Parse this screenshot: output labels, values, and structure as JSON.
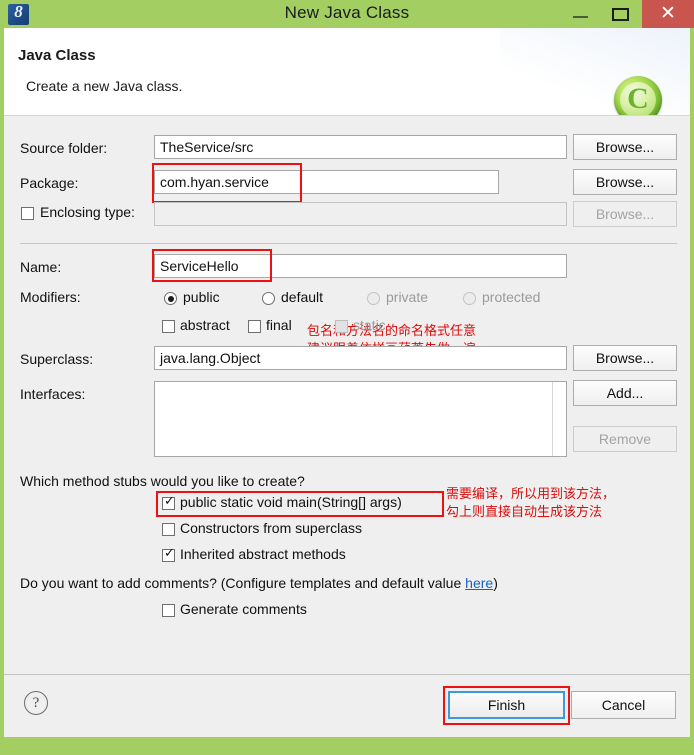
{
  "window": {
    "title": "New Java Class",
    "app_icon": "eclipse-icon",
    "minimize_label": "Minimize",
    "maximize_label": "Maximize",
    "close_label": "Close",
    "close_color": "#c9554f",
    "titlebar_color": "#a3cf62"
  },
  "header": {
    "title": "Java Class",
    "subtitle": "Create a new Java class.",
    "icon": "java-class-icon",
    "icon_letter": "C"
  },
  "form": {
    "source_folder": {
      "label": "Source folder:",
      "value": "TheService/src",
      "browse": "Browse..."
    },
    "package": {
      "label": "Package:",
      "value": "com.hyan.service",
      "browse": "Browse..."
    },
    "enclosing_type": {
      "label": "Enclosing type:",
      "checked": false,
      "value": "",
      "browse": "Browse..."
    },
    "name": {
      "label": "Name:",
      "value": "ServiceHello"
    },
    "modifiers": {
      "label": "Modifiers:",
      "radios": [
        {
          "label": "public",
          "selected": true,
          "enabled": true
        },
        {
          "label": "default",
          "selected": false,
          "enabled": true
        },
        {
          "label": "private",
          "selected": false,
          "enabled": false
        },
        {
          "label": "protected",
          "selected": false,
          "enabled": false
        }
      ],
      "checkboxes": [
        {
          "label": "abstract",
          "checked": false,
          "enabled": true
        },
        {
          "label": "final",
          "checked": false,
          "enabled": true
        },
        {
          "label": "static",
          "checked": false,
          "enabled": false
        }
      ]
    },
    "superclass": {
      "label": "Superclass:",
      "value": "java.lang.Object",
      "browse": "Browse..."
    },
    "interfaces": {
      "label": "Interfaces:",
      "items": [],
      "add": "Add...",
      "remove": "Remove"
    },
    "method_stubs": {
      "question": "Which method stubs would you like to create?",
      "options": [
        {
          "label": "public static void main(String[] args)",
          "checked": true
        },
        {
          "label": "Constructors from superclass",
          "checked": false
        },
        {
          "label": "Inherited abstract methods",
          "checked": true
        }
      ]
    },
    "comments": {
      "question_before": "Do you want to add comments? (Configure templates and default value ",
      "link": "here",
      "question_after": ")",
      "option": {
        "label": "Generate comments",
        "checked": false
      }
    }
  },
  "annotations": {
    "color": "#dd0b0b",
    "package_note": [
      "包名和方法名的命名格式任意",
      "建议跟着依样画葫芦先做一遍"
    ],
    "main_note": [
      "需要编译，所以用到该方法，",
      "勾上则直接自动生成该方法"
    ]
  },
  "footer": {
    "help": "?",
    "finish": "Finish",
    "cancel": "Cancel"
  }
}
